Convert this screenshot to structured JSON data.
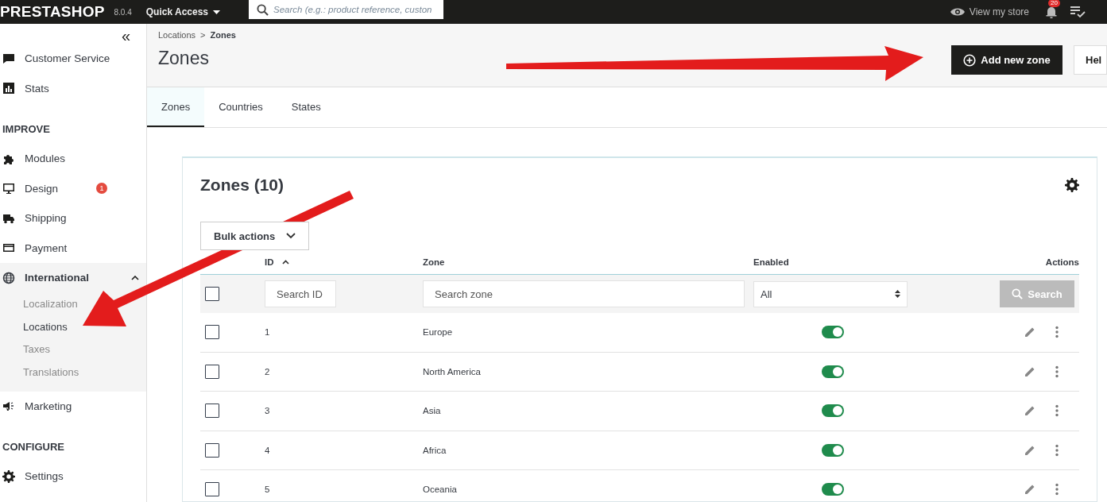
{
  "topbar": {
    "logo": "PRESTASHOP",
    "version": "8.0.4",
    "quick_access": "Quick Access",
    "search": {
      "placeholder": "Search (e.g.: product reference, custon"
    },
    "view_store": "View my store",
    "notifications": "20"
  },
  "sidebar": {
    "collapse": "«",
    "items": [
      {
        "kind": "item",
        "label": "Customer Service"
      },
      {
        "kind": "item",
        "label": "Stats"
      },
      {
        "kind": "section",
        "label": "IMPROVE"
      },
      {
        "kind": "item",
        "label": "Modules"
      },
      {
        "kind": "item",
        "label": "Design",
        "badge": "1"
      },
      {
        "kind": "item",
        "label": "Shipping"
      },
      {
        "kind": "item",
        "label": "Payment"
      },
      {
        "kind": "group",
        "label": "International",
        "expanded": true,
        "children": [
          {
            "label": "Localization",
            "selected": false
          },
          {
            "label": "Locations",
            "selected": true
          },
          {
            "label": "Taxes",
            "selected": false
          },
          {
            "label": "Translations",
            "selected": false
          }
        ]
      },
      {
        "kind": "item",
        "label": "Marketing"
      },
      {
        "kind": "section",
        "label": "CONFIGURE"
      },
      {
        "kind": "item",
        "label": "Settings"
      }
    ]
  },
  "breadcrumb": {
    "separator": ">",
    "items": [
      "Locations",
      "Zones"
    ]
  },
  "page_title": "Zones",
  "toolbar": {
    "add": "Add new zone",
    "help": "Hel"
  },
  "tabs": [
    {
      "label": "Zones",
      "selected": true
    },
    {
      "label": "Countries",
      "selected": false
    },
    {
      "label": "States",
      "selected": false
    }
  ],
  "card": {
    "title": "Zones (10)",
    "bulk_actions": "Bulk actions"
  },
  "table": {
    "columns": [
      "ID",
      "Zone",
      "Enabled",
      "Actions"
    ],
    "filters": {
      "select_all": false,
      "id_placeholder": "Search ID",
      "zone_placeholder": "Search zone",
      "enabled_value": "All",
      "search": "Search"
    },
    "rows": [
      {
        "checked": false,
        "id": "1",
        "zone": "Europe",
        "enabled": true
      },
      {
        "checked": false,
        "id": "2",
        "zone": "North America",
        "enabled": true
      },
      {
        "checked": false,
        "id": "3",
        "zone": "Asia",
        "enabled": true
      },
      {
        "checked": false,
        "id": "4",
        "zone": "Africa",
        "enabled": true
      },
      {
        "checked": false,
        "id": "5",
        "zone": "Oceania",
        "enabled": true
      }
    ]
  }
}
